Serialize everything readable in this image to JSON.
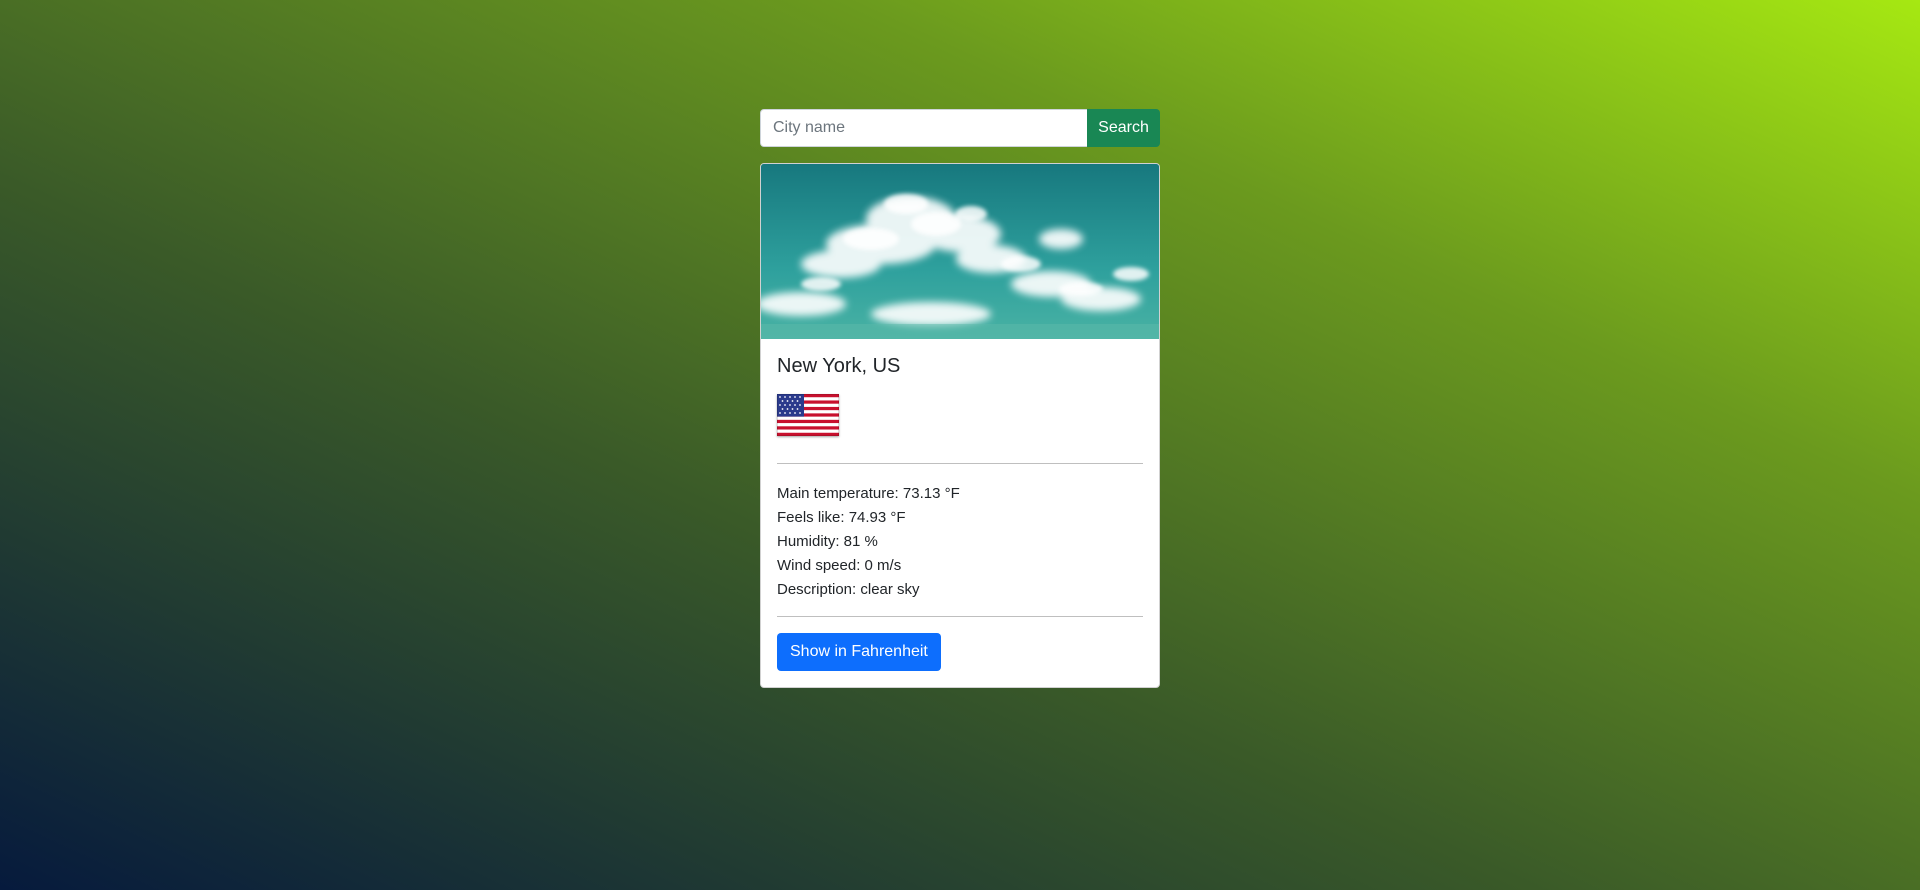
{
  "search": {
    "placeholder": "City name",
    "value": "",
    "button_label": "Search"
  },
  "card": {
    "image_icon": "clouds-sky-image",
    "city": "New York, US",
    "flag_icon": "us-flag-icon",
    "details": {
      "main_temperature": "Main temperature: 73.13 °F",
      "feels_like": "Feels like: 74.93 °F",
      "humidity": "Humidity: 81 %",
      "wind_speed": "Wind speed: 0 m/s",
      "description": "Description: clear sky"
    },
    "toggle_label": "Show in Fahrenheit"
  },
  "colors": {
    "search_button": "#198754",
    "toggle_button": "#0d6efd"
  }
}
